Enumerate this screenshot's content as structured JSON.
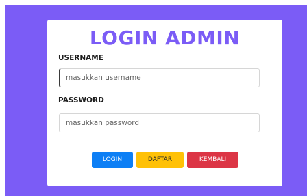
{
  "login_card": {
    "title": "LOGIN ADMIN",
    "username_label": "USERNAME",
    "username_placeholder": "masukkan username",
    "username_value": "",
    "password_label": "PASSWORD",
    "password_placeholder": "masukkan password",
    "password_value": "",
    "login_button": "LOGIN",
    "register_button": "DAFTAR",
    "back_button": "KEMBALI"
  },
  "colors": {
    "accent": "#7b5cf6",
    "login_button_bg": "#0d7ff5",
    "register_button_bg": "#ffc107",
    "back_button_bg": "#dc3545"
  }
}
